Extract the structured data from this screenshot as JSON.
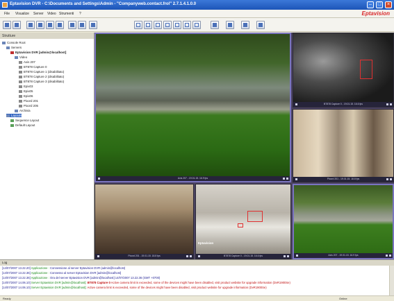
{
  "window": {
    "title": "Eptavision DVR - C:\\Documents and Settings\\Admin - \"Companyweb.contact.frol\" 2.7.1.4.1.0.0",
    "brand": "Eptavision"
  },
  "menu": [
    "File",
    "Visualize",
    "Server",
    "Video",
    "Strumenti",
    "?"
  ],
  "sidebar": {
    "header": "Strutture",
    "tree": [
      "Console Root",
      "Servers",
      "Eptavision DVR [admin@localhost]",
      "Video",
      "Axis 207",
      "BT878 Capture 0",
      "BT878 Capture 1 (disabilitato)",
      "BT878 Capture 2 (disabilitato)",
      "BT878 Capture 3 (disabilitato)",
      "Epix03",
      "Epix05",
      "Epix06",
      "Pixord 201",
      "Pixord 205",
      "Archivia",
      "Layouts",
      "Sequence Layout",
      "Default Layout"
    ]
  },
  "tiles": [
    {
      "caption": "Axis 207 - 19.01.15. 16.9 fps"
    },
    {
      "caption": "BT878 Capture 0 - 19.01.15. 16.6 fps"
    },
    {
      "caption": "Pixord 201 - 19.01.15. 18.8 fps"
    },
    {
      "caption": "Pixord 201 - 19.01.15. 18.8 fps"
    },
    {
      "caption": "BT878 Capture 0 - 19.01.15. 16.6 fps"
    },
    {
      "caption": "Axis 207 - 19.01.15. 16.9 fps"
    }
  ],
  "overlay_brand": "Eptavision",
  "console": {
    "header": "Log",
    "lines": [
      {
        "ts": "[14/07/2007 13.22.20]",
        "src": "Applicazione :",
        "msg": "Connessione al server Eptavision DVR (admin@localhost)",
        "warn": false,
        "hl": ""
      },
      {
        "ts": "[14/07/2007 13.22.36]",
        "src": "Applicazione :",
        "msg": "Connesso al server Eptavision DVR [admin@localhost]",
        "warn": false,
        "hl": ""
      },
      {
        "ts": "[14/07/2007 13.22.36]",
        "src": "Applicazione :",
        "msg": "Ora del server Eptavision DVR [admin@localhost] 14/07/2007 13.22.36 (GMT +0700)",
        "warn": false,
        "hl": ""
      },
      {
        "ts": "[14/07/2007 14.06.10]",
        "src": "Server Eptavision DVR [admin@localhost]:",
        "msg": "Active camera limit is exceeded, some of the devices might have been disabled, visit product website for upgrade information (DvR1900Se)",
        "warn": true,
        "hl": "BT878 Capture 0"
      },
      {
        "ts": "[14/07/2007 14.06.10]",
        "src": "Server Eptavision DVR [admin@localhost]:",
        "msg": "Active camera limit is exceeded, some of the devices might have been disabled, visit product website for upgrade information (DvR1900Se)",
        "warn": true,
        "hl": ""
      }
    ]
  },
  "status": {
    "left": "Ready",
    "right": "Online"
  }
}
